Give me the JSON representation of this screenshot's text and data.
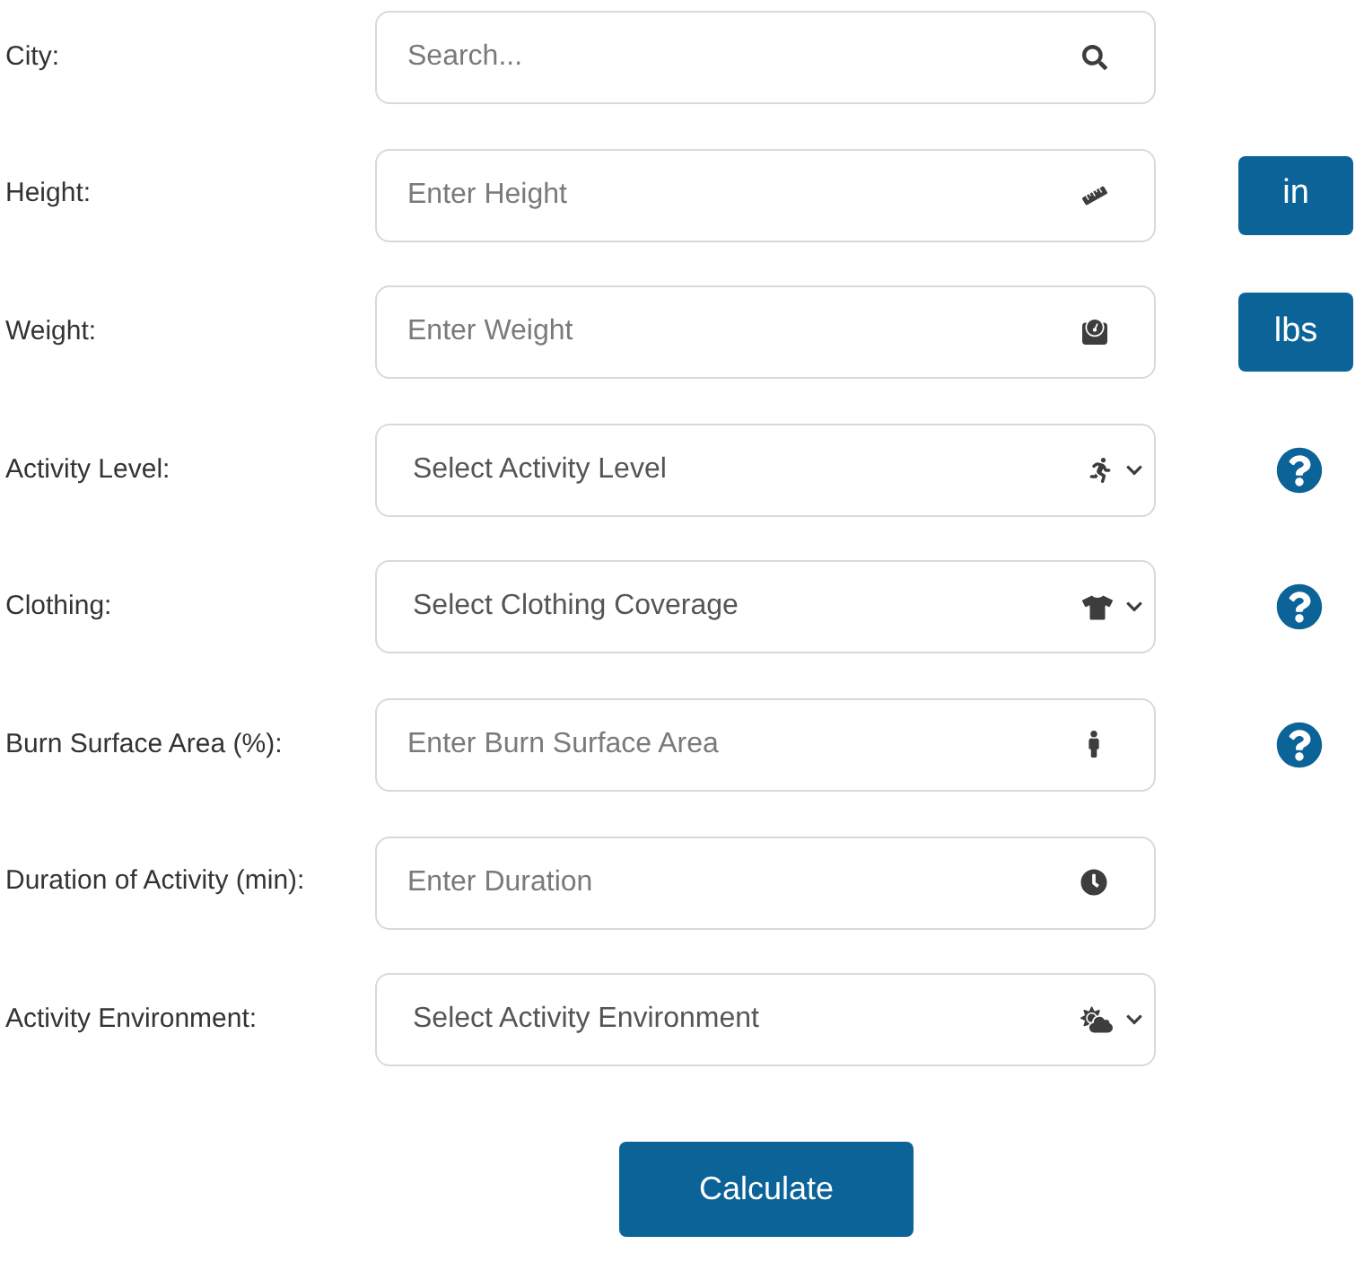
{
  "fields": [
    {
      "label": "City:",
      "kind": "input",
      "placeholder": "Search...",
      "help": false
    },
    {
      "label": "Height:",
      "kind": "input",
      "placeholder": "Enter Height",
      "unit": "in",
      "help": false
    },
    {
      "label": "Weight:",
      "kind": "input",
      "placeholder": "Enter Weight",
      "unit": "lbs",
      "help": false
    },
    {
      "label": "Activity Level:",
      "kind": "select",
      "placeholder": "Select Activity Level",
      "help": true
    },
    {
      "label": "Clothing:",
      "kind": "select",
      "placeholder": "Select Clothing Coverage",
      "help": true
    },
    {
      "label": "Burn Surface Area (%):",
      "kind": "input",
      "placeholder": "Enter Burn Surface Area",
      "help": true
    },
    {
      "label": "Duration of Activity (min):",
      "kind": "input",
      "placeholder": "Enter Duration",
      "help": false
    },
    {
      "label": "Activity Environment:",
      "kind": "select",
      "placeholder": "Select Activity Environment",
      "help": false
    }
  ],
  "button": "Calculate"
}
